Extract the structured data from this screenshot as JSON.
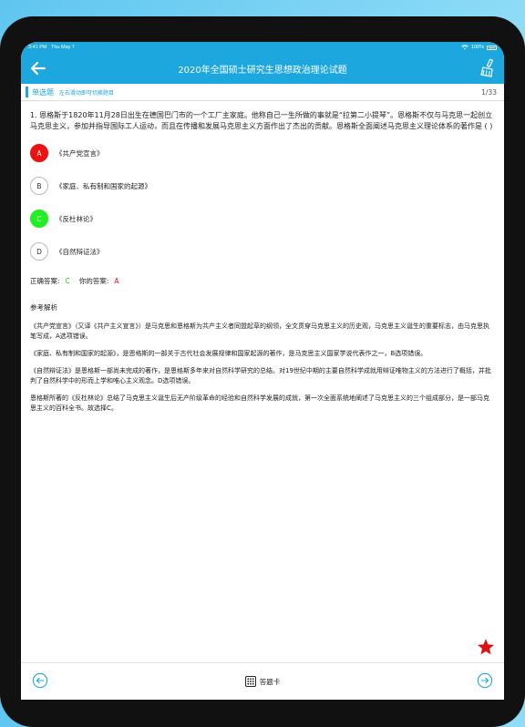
{
  "status_bar": {
    "time": "3:41 PM",
    "date": "Thu May 7",
    "battery": "100%"
  },
  "header": {
    "title": "2020年全国硕士研究生思想政治理论试题"
  },
  "subheader": {
    "question_type": "单选题",
    "hint": "左右滑动即可切换题目",
    "progress": "1/33"
  },
  "question": {
    "text": "1. 恩格斯于1820年11月28日出生在德国巴门市的一个工厂主家庭。他称自己一生所做的事就是“拉第二小提琴”。恩格斯不仅与马克思一起创立马克思主义，参加并指导国际工人运动，而且在传播和发展马克思主义方面作出了杰出的贡献。恩格斯全面阐述马克思主义理论体系的著作是 ( )",
    "options": [
      {
        "letter": "A",
        "text": "《共产党宣言》",
        "state": "wrong"
      },
      {
        "letter": "B",
        "text": "《家庭、私有制和国家的起源》",
        "state": "none"
      },
      {
        "letter": "C",
        "text": "《反杜林论》",
        "state": "right"
      },
      {
        "letter": "D",
        "text": "《自然辩证法》",
        "state": "none"
      }
    ]
  },
  "answer": {
    "correct_label": "正确答案:",
    "correct_value": "C",
    "yours_label": "你的答案:",
    "yours_value": "A"
  },
  "analysis": {
    "title": "参考解析",
    "paragraphs": [
      "《共产党宣言》（又译《共产主义宣言》）是马克思和恩格斯为共产主义者同盟起草的纲领，全文贯穿马克思主义的历史观，马克思主义诞生的重要标志，由马克思执笔写成，A选项错误。",
      "《家庭、私有制和国家的起源》，是恩格斯的一部关于古代社会发展规律和国家起源的著作，是马克思主义国家学说代表作之一，B选项错误。",
      "《自然辩证法》是恩格斯一部尚未完成的著作，是恩格斯多年来对自然科学研究的总结。对19世纪中期的主要自然科学成就用辩证唯物主义的方法进行了概括，并批判了自然科学中的形而上学和唯心主义观念。D选项错误。",
      "恩格斯所著的《反杜林论》总结了马克思主义诞生后无产阶级革命的经验和自然科学发展的成就，第一次全面系统地阐述了马克思主义的三个组成部分，是一部马克思主义的百科全书。故选择C。"
    ]
  },
  "footer": {
    "answer_card_label": "答题卡"
  },
  "colors": {
    "accent": "#1ca7df",
    "wrong": "#ee1111",
    "right": "#22ee22",
    "star": "#dd1111"
  }
}
